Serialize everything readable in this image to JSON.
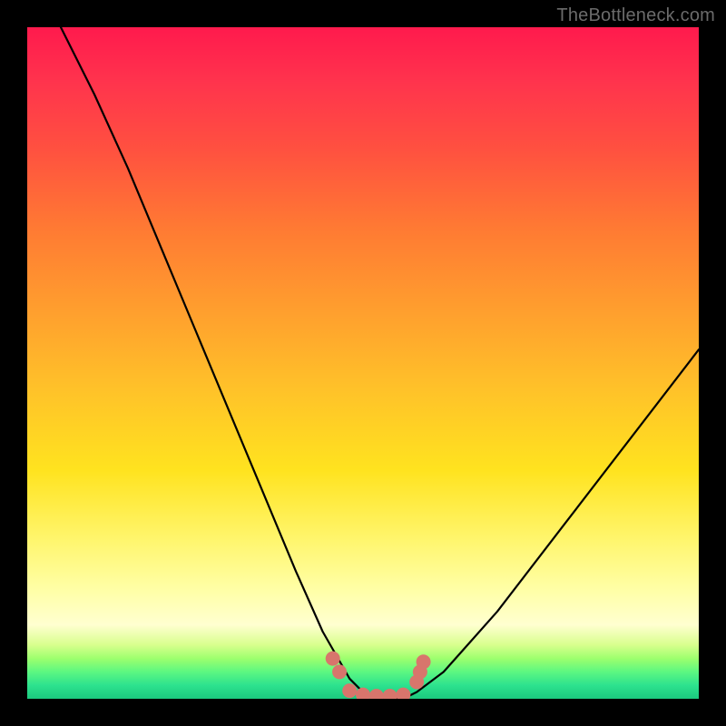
{
  "watermark": "TheBottleneck.com",
  "chart_data": {
    "type": "line",
    "title": "",
    "xlabel": "",
    "ylabel": "",
    "xlim": [
      0,
      100
    ],
    "ylim": [
      0,
      100
    ],
    "series": [
      {
        "name": "bottleneck-curve",
        "x": [
          5,
          10,
          15,
          20,
          25,
          30,
          35,
          40,
          44,
          48,
          50,
          52,
          54,
          56,
          58,
          62,
          70,
          80,
          90,
          100
        ],
        "values": [
          100,
          90,
          79,
          67,
          55,
          43,
          31,
          19,
          10,
          3,
          1,
          0,
          0,
          0,
          1,
          4,
          13,
          26,
          39,
          52
        ]
      }
    ],
    "markers": {
      "name": "highlight-dots",
      "color": "#d8756c",
      "points": [
        {
          "x": 45.5,
          "y": 6.0
        },
        {
          "x": 46.5,
          "y": 4.0
        },
        {
          "x": 48.0,
          "y": 1.2
        },
        {
          "x": 50.0,
          "y": 0.6
        },
        {
          "x": 52.0,
          "y": 0.4
        },
        {
          "x": 54.0,
          "y": 0.4
        },
        {
          "x": 56.0,
          "y": 0.6
        },
        {
          "x": 58.0,
          "y": 2.5
        },
        {
          "x": 58.5,
          "y": 4.0
        },
        {
          "x": 59.0,
          "y": 5.5
        }
      ]
    }
  }
}
